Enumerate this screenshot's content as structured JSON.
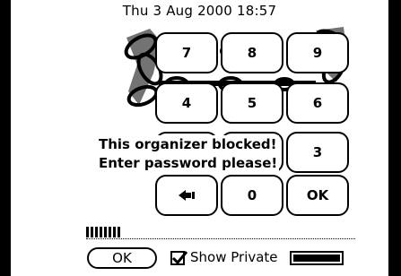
{
  "status_bar": {
    "datetime": "Thu 3 Aug 2000  18:57"
  },
  "keypad": {
    "rows": [
      [
        "7",
        "8",
        "9"
      ],
      [
        "4",
        "5",
        "6"
      ],
      [
        "3"
      ],
      [
        "0",
        "OK"
      ]
    ],
    "backspace_icon": "backspace-arrow-icon"
  },
  "message": {
    "line1": "This organizer blocked!",
    "line2": "Enter password please!"
  },
  "password_entry": {
    "characters_entered": 8
  },
  "footer": {
    "ok_label": "OK",
    "show_private_label": "Show Private",
    "show_private_checked": true
  }
}
